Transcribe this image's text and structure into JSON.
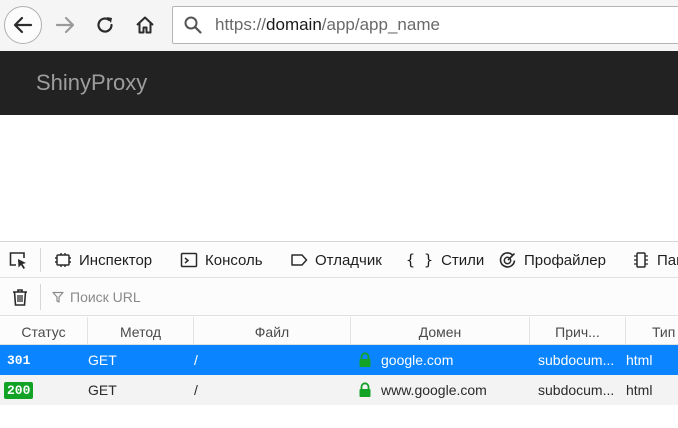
{
  "browser": {
    "url_prefix": "https://",
    "url_domain": "domain",
    "url_path": "/app/app_name",
    "icons": [
      "back-arrow-icon",
      "forward-arrow-icon",
      "reload-icon",
      "home-icon",
      "search-icon"
    ]
  },
  "page": {
    "brand": "ShinyProxy",
    "navbar_color": "#222222"
  },
  "devtools": {
    "tabs": [
      {
        "label": "Инспектор",
        "icon": "inspector-icon"
      },
      {
        "label": "Консоль",
        "icon": "console-icon"
      },
      {
        "label": "Отладчик",
        "icon": "debugger-icon"
      },
      {
        "label": "Стили",
        "icon": "braces-icon"
      },
      {
        "label": "Профайлер",
        "icon": "profiler-icon"
      },
      {
        "label": "Пам",
        "icon": "memory-icon"
      }
    ],
    "filter_placeholder": "Поиск URL",
    "columns": [
      "Статус",
      "Метод",
      "Файл",
      "Домен",
      "Прич...",
      "Тип"
    ],
    "rows": [
      {
        "status": "301",
        "method": "GET",
        "file": "/",
        "domain": "google.com",
        "cause": "subdocum...",
        "type": "html",
        "selected": true
      },
      {
        "status": "200",
        "method": "GET",
        "file": "/",
        "domain": "www.google.com",
        "cause": "subdocum...",
        "type": "html",
        "selected": false
      }
    ],
    "colors": {
      "selected_row": "#0a84ff",
      "status_ok": "#12a326",
      "lock": "#12a326"
    }
  }
}
